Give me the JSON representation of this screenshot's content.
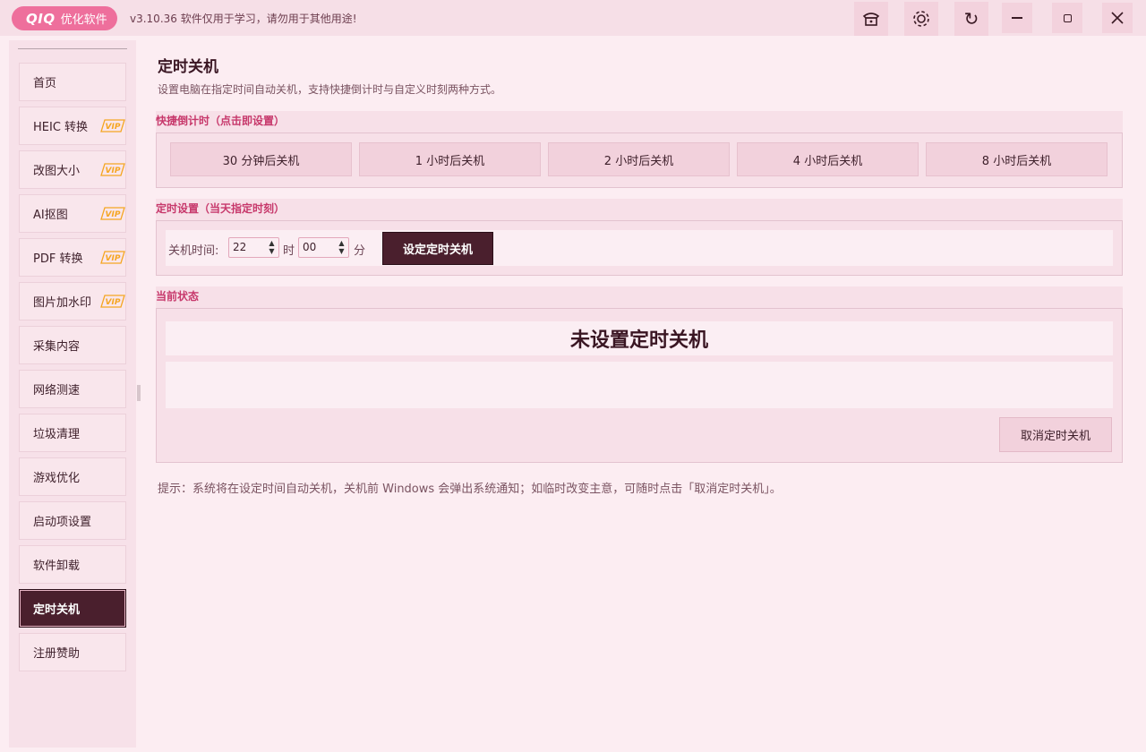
{
  "app": {
    "logo_mark": "QIQ",
    "logo_text": "优化软件",
    "version_text": "v3.10.36  软件仅用于学习，请勿用于其他用途!"
  },
  "titlebar_icons": [
    "hat-icon",
    "gear-icon",
    "refresh-icon"
  ],
  "window_controls": [
    "minimize-icon",
    "maximize-icon",
    "close-icon"
  ],
  "sidebar": {
    "items": [
      {
        "label": "首页",
        "vip": false
      },
      {
        "label": "HEIC 转换",
        "vip": true
      },
      {
        "label": "改图大小",
        "vip": true
      },
      {
        "label": "AI抠图",
        "vip": true
      },
      {
        "label": "PDF 转换",
        "vip": true
      },
      {
        "label": "图片加水印",
        "vip": true
      },
      {
        "label": "采集内容",
        "vip": false
      },
      {
        "label": "网络测速",
        "vip": false
      },
      {
        "label": "垃圾清理",
        "vip": false
      },
      {
        "label": "游戏优化",
        "vip": false
      },
      {
        "label": "启动项设置",
        "vip": false
      },
      {
        "label": "软件卸载",
        "vip": false
      },
      {
        "label": "定时关机",
        "vip": false,
        "active": true
      },
      {
        "label": "注册赞助",
        "vip": false
      }
    ],
    "vip_badge": "VIP"
  },
  "main": {
    "title": "定时关机",
    "description": "设置电脑在指定时间自动关机，支持快捷倒计时与自定义时刻两种方式。",
    "quick": {
      "label": "快捷倒计时（点击即设置）",
      "buttons": [
        "30 分钟后关机",
        "1 小时后关机",
        "2 小时后关机",
        "4 小时后关机",
        "8 小时后关机"
      ]
    },
    "timer": {
      "label": "定时设置（当天指定时刻）",
      "time_label": "关机时间:",
      "hour_value": "22",
      "hour_unit": "时",
      "minute_value": "00",
      "minute_unit": "分",
      "set_button": "设定定时关机"
    },
    "status": {
      "label": "当前状态",
      "value": "未设置定时关机",
      "detail": "",
      "cancel_button": "取消定时关机"
    },
    "tip": "提示：系统将在设定时间自动关机，关机前 Windows 会弹出系统通知；如临时改变主意，可随时点击「取消定时关机」。"
  },
  "colors": {
    "accent": "#ee6f9c",
    "active_nav": "#4a1f2d",
    "section_label": "#c7386b",
    "background": "#fcedf2"
  }
}
